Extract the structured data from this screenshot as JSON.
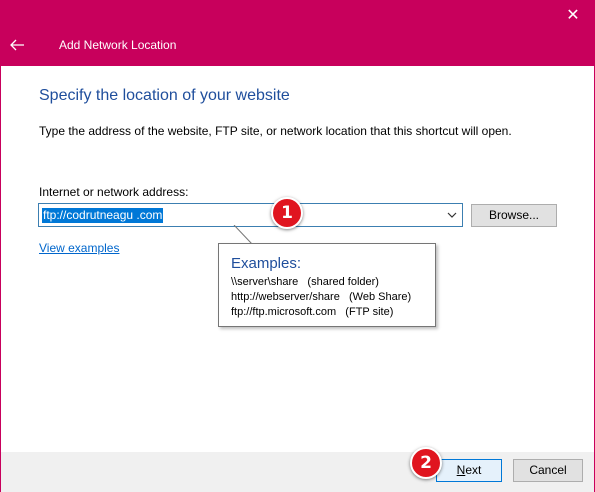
{
  "window": {
    "title": "Add Network Location",
    "close_glyph": "✕",
    "accent_color": "#c8005c"
  },
  "page": {
    "heading": "Specify the location of your website",
    "instruction": "Type the address of the website, FTP site, or network location that this shortcut will open.",
    "field_label": "Internet or network address:",
    "address_value": "ftp://codrutneagu            .com",
    "browse_label": "Browse...",
    "view_examples_link": "View examples"
  },
  "tooltip": {
    "title": "Examples:",
    "lines": [
      "\\\\server\\share   (shared folder)",
      "http://webserver/share   (Web Share)",
      "ftp://ftp.microsoft.com   (FTP site)"
    ]
  },
  "badges": {
    "one": "1",
    "two": "2",
    "color": "#e0151f"
  },
  "footer": {
    "next_underlined": "N",
    "next_rest": "ext",
    "cancel_label": "Cancel"
  }
}
